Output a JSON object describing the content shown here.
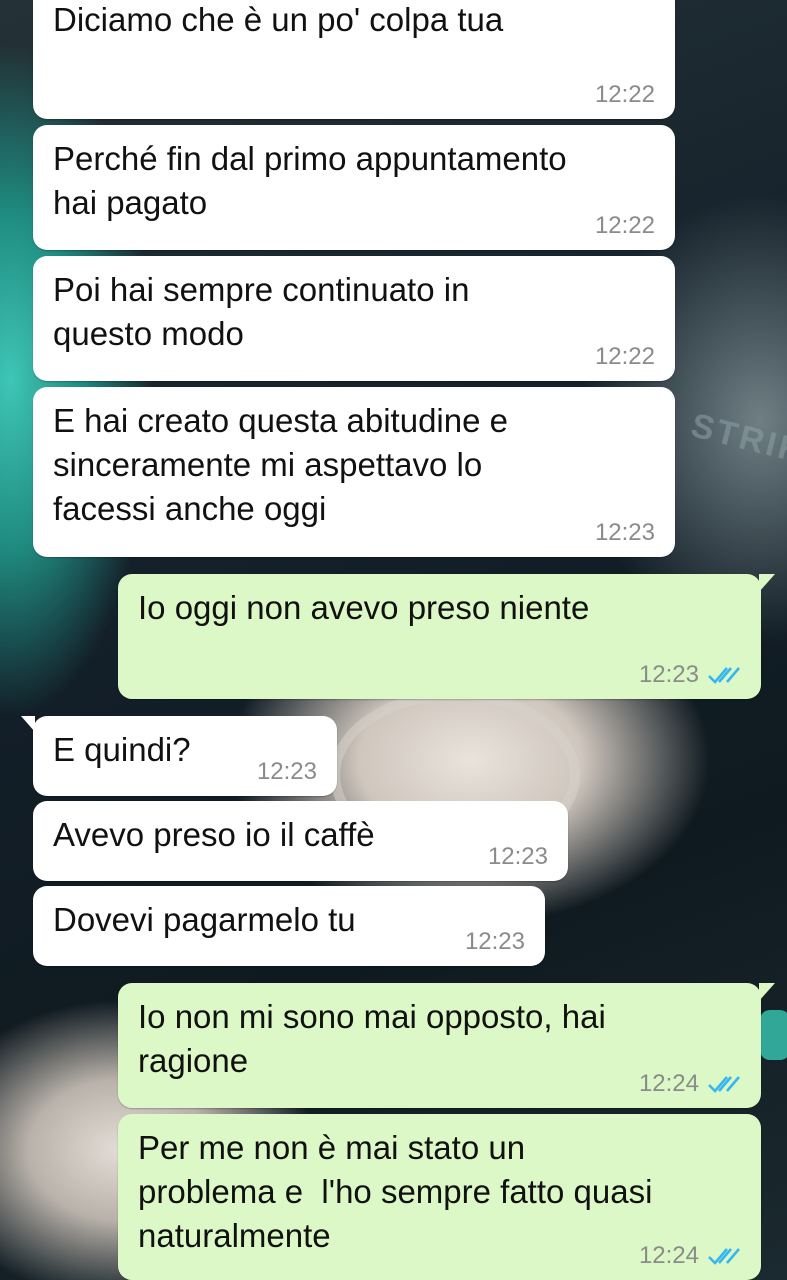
{
  "background": {
    "watermark_text": "STRIK"
  },
  "colors": {
    "incoming_bubble": "#ffffff",
    "outgoing_bubble": "#dcf8c6",
    "read_ticks": "#34b7f1",
    "time": "#8b8b8b"
  },
  "messages": [
    {
      "direction": "in",
      "text": "Diciamo che è un po' colpa tua",
      "time": "12:22"
    },
    {
      "direction": "in",
      "text": "Perché fin dal primo appuntamento\nhai pagato",
      "time": "12:22"
    },
    {
      "direction": "in",
      "text": "Poi hai sempre continuato in\nquesto modo",
      "time": "12:22"
    },
    {
      "direction": "in",
      "text": "E hai creato questa abitudine e\nsinceramente mi aspettavo lo\nfacessi anche oggi",
      "time": "12:23"
    },
    {
      "direction": "out",
      "text": "Io oggi non avevo preso niente",
      "time": "12:23",
      "status": "read"
    },
    {
      "direction": "in",
      "text": "E quindi?",
      "time": "12:23"
    },
    {
      "direction": "in",
      "text": "Avevo preso io il caffè",
      "time": "12:23"
    },
    {
      "direction": "in",
      "text": "Dovevi pagarmelo tu",
      "time": "12:23"
    },
    {
      "direction": "out",
      "text": "Io non mi sono mai opposto, hai\nragione",
      "time": "12:24",
      "status": "read"
    },
    {
      "direction": "out",
      "text": "Per me non è mai stato un\nproblema e  l'ho sempre fatto quasi\nnaturalmente",
      "time": "12:24",
      "status": "read"
    }
  ]
}
